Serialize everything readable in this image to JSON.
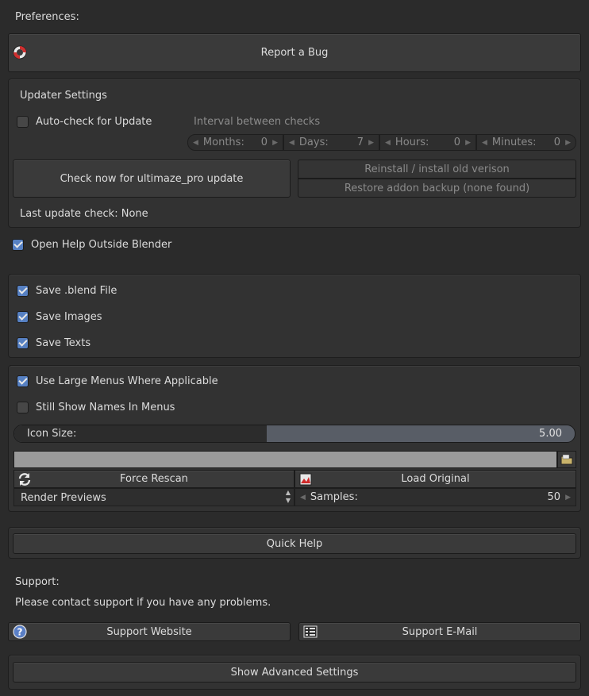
{
  "preferences_title": "Preferences:",
  "report_bug": "Report a Bug",
  "updater": {
    "title": "Updater Settings",
    "autocheck_label": "Auto-check for Update",
    "interval_label": "Interval between checks",
    "months": {
      "label": "Months:",
      "value": "0"
    },
    "days": {
      "label": "Days:",
      "value": "7"
    },
    "hours": {
      "label": "Hours:",
      "value": "0"
    },
    "minutes": {
      "label": "Minutes:",
      "value": "0"
    },
    "check_now": "Check now for ultimaze_pro update",
    "reinstall": "Reinstall / install old verison",
    "restore": "Restore addon backup (none found)",
    "last_check": "Last update check: None"
  },
  "open_help_outside": "Open Help Outside Blender",
  "save": {
    "blend": "Save .blend File",
    "images": "Save Images",
    "texts": "Save Texts"
  },
  "menus": {
    "large_menus": "Use Large Menus Where Applicable",
    "show_names": "Still Show Names In Menus",
    "icon_size_label": "Icon Size:",
    "icon_size_value": "5.00",
    "icon_size_fraction": 0.45,
    "path_value": "",
    "force_rescan": "Force Rescan",
    "load_original": "Load Original",
    "render_previews": "Render Previews",
    "samples_label": "Samples:",
    "samples_value": "50"
  },
  "quick_help": "Quick Help",
  "support": {
    "title": "Support:",
    "message": "Please contact support if you have any problems.",
    "website": "Support Website",
    "email": "Support E-Mail"
  },
  "show_advanced": "Show Advanced Settings",
  "colors": {
    "background": "#2b2b2b",
    "panel": "#323232",
    "checkbox_on": "#5680c2",
    "slider_fill": "#585d66"
  }
}
